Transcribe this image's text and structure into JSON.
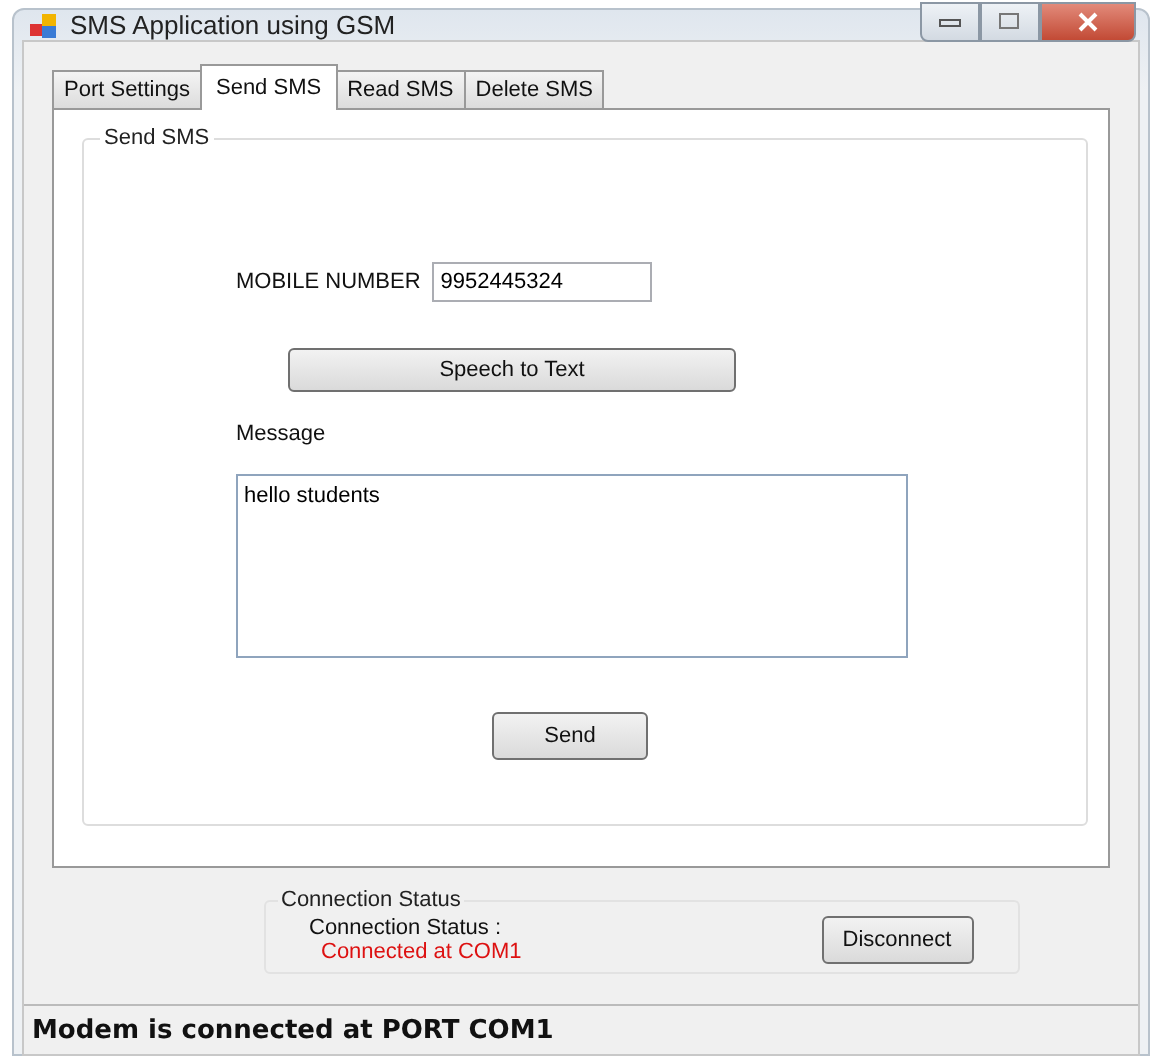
{
  "window": {
    "title": "SMS Application using GSM"
  },
  "tabs": [
    {
      "label": "Port Settings",
      "selected": false
    },
    {
      "label": "Send SMS",
      "selected": true
    },
    {
      "label": "Read SMS",
      "selected": false
    },
    {
      "label": "Delete SMS",
      "selected": false
    }
  ],
  "send_group": {
    "title": "Send SMS",
    "mobile_label": "MOBILE NUMBER",
    "mobile_value": "9952445324",
    "speech_button": "Speech to Text",
    "message_label": "Message",
    "message_value": "hello students",
    "send_button": "Send"
  },
  "connection_group": {
    "title": "Connection Status",
    "status_label": "Connection Status :",
    "status_value": "Connected at COM1",
    "disconnect_button": "Disconnect"
  },
  "status_bar": "Modem is connected at PORT COM1"
}
